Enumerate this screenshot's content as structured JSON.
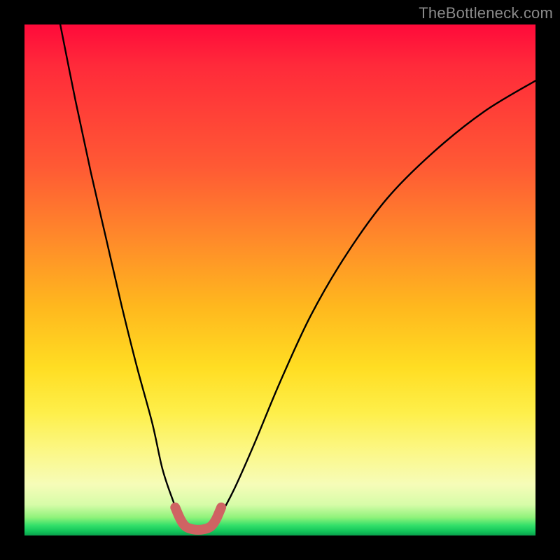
{
  "watermark": "TheBottleneck.com",
  "chart_data": {
    "type": "line",
    "title": "",
    "xlabel": "",
    "ylabel": "",
    "xlim": [
      0,
      100
    ],
    "ylim": [
      0,
      100
    ],
    "grid": false,
    "legend": false,
    "series": [
      {
        "name": "curve-left",
        "x": [
          7,
          10,
          13,
          16,
          19,
          22,
          25,
          27,
          29,
          30.5,
          31.5
        ],
        "y": [
          100,
          85,
          71,
          58,
          45,
          33,
          22,
          13,
          7,
          3.2,
          1.8
        ]
      },
      {
        "name": "valley-floor",
        "x": [
          31.5,
          33,
          35,
          36.5
        ],
        "y": [
          1.8,
          1.2,
          1.2,
          1.8
        ]
      },
      {
        "name": "curve-right",
        "x": [
          36.5,
          38,
          41,
          45,
          50,
          56,
          63,
          71,
          80,
          90,
          100
        ],
        "y": [
          1.8,
          3.5,
          9,
          18,
          30,
          43,
          55,
          66,
          75,
          83,
          89
        ]
      }
    ],
    "highlight": {
      "name": "valley-highlight",
      "color": "#d06a6a",
      "x": [
        29.5,
        30.5,
        31.5,
        33,
        35,
        36.5,
        37.5,
        38.5
      ],
      "y": [
        5.5,
        3.2,
        1.8,
        1.2,
        1.2,
        1.8,
        3.2,
        5.5
      ]
    },
    "background_gradient": {
      "top": "#ff0a3a",
      "mid_upper": "#ff8a2a",
      "mid": "#ffdd22",
      "mid_lower": "#f6fcb8",
      "bottom": "#12c45a"
    }
  }
}
